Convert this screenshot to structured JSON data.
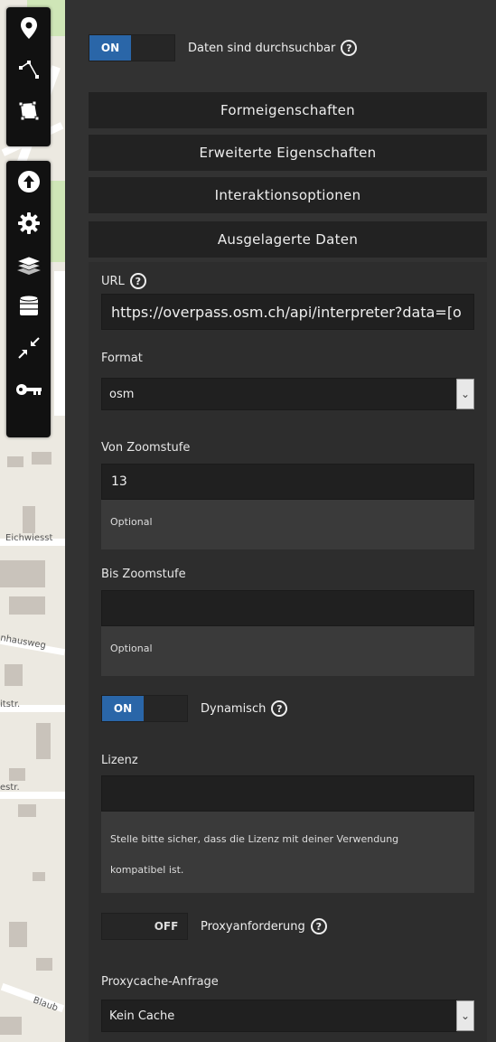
{
  "toolbar_top": [
    {
      "icon": "marker-icon"
    },
    {
      "icon": "polyline-icon"
    },
    {
      "icon": "polygon-icon"
    }
  ],
  "toolbar_bottom": [
    {
      "icon": "upload-icon"
    },
    {
      "icon": "gear-icon"
    },
    {
      "icon": "layers-icon"
    },
    {
      "icon": "database-icon"
    },
    {
      "icon": "shrink-icon"
    },
    {
      "icon": "key-icon"
    }
  ],
  "map_labels": {
    "street1": "Eichwiesst",
    "street2": "nhausweg",
    "street3": "itstr.",
    "street4": "estr.",
    "street5": "Blaub"
  },
  "searchable": {
    "state": "ON",
    "label": "Daten sind durchsuchbar"
  },
  "sections": {
    "shape": "Formeigenschaften",
    "advanced": "Erweiterte Eigenschaften",
    "interaction": "Interaktionsoptionen",
    "remote": "Ausgelagerte Daten"
  },
  "remote": {
    "url_label": "URL",
    "url_value": "https://overpass.osm.ch/api/interpreter?data=[o",
    "format_label": "Format",
    "format_value": "osm",
    "from_zoom_label": "Von Zoomstufe",
    "from_zoom_value": "13",
    "from_zoom_hint": "Optional",
    "to_zoom_label": "Bis Zoomstufe",
    "to_zoom_value": "",
    "to_zoom_hint": "Optional",
    "dynamic_state": "ON",
    "dynamic_label": "Dynamisch",
    "license_label": "Lizenz",
    "license_value": "",
    "license_hint_line1": "Stelle bitte sicher, dass die Lizenz mit deiner Verwendung",
    "license_hint_line2": "kompatibel ist.",
    "proxy_state": "OFF",
    "proxy_label": "Proxyanforderung",
    "cache_label": "Proxycache-Anfrage",
    "cache_value": "Kein Cache"
  },
  "help_glyph": "?",
  "colors": {
    "accent": "#2a66a8",
    "panel": "#323232",
    "section": "#222222"
  }
}
